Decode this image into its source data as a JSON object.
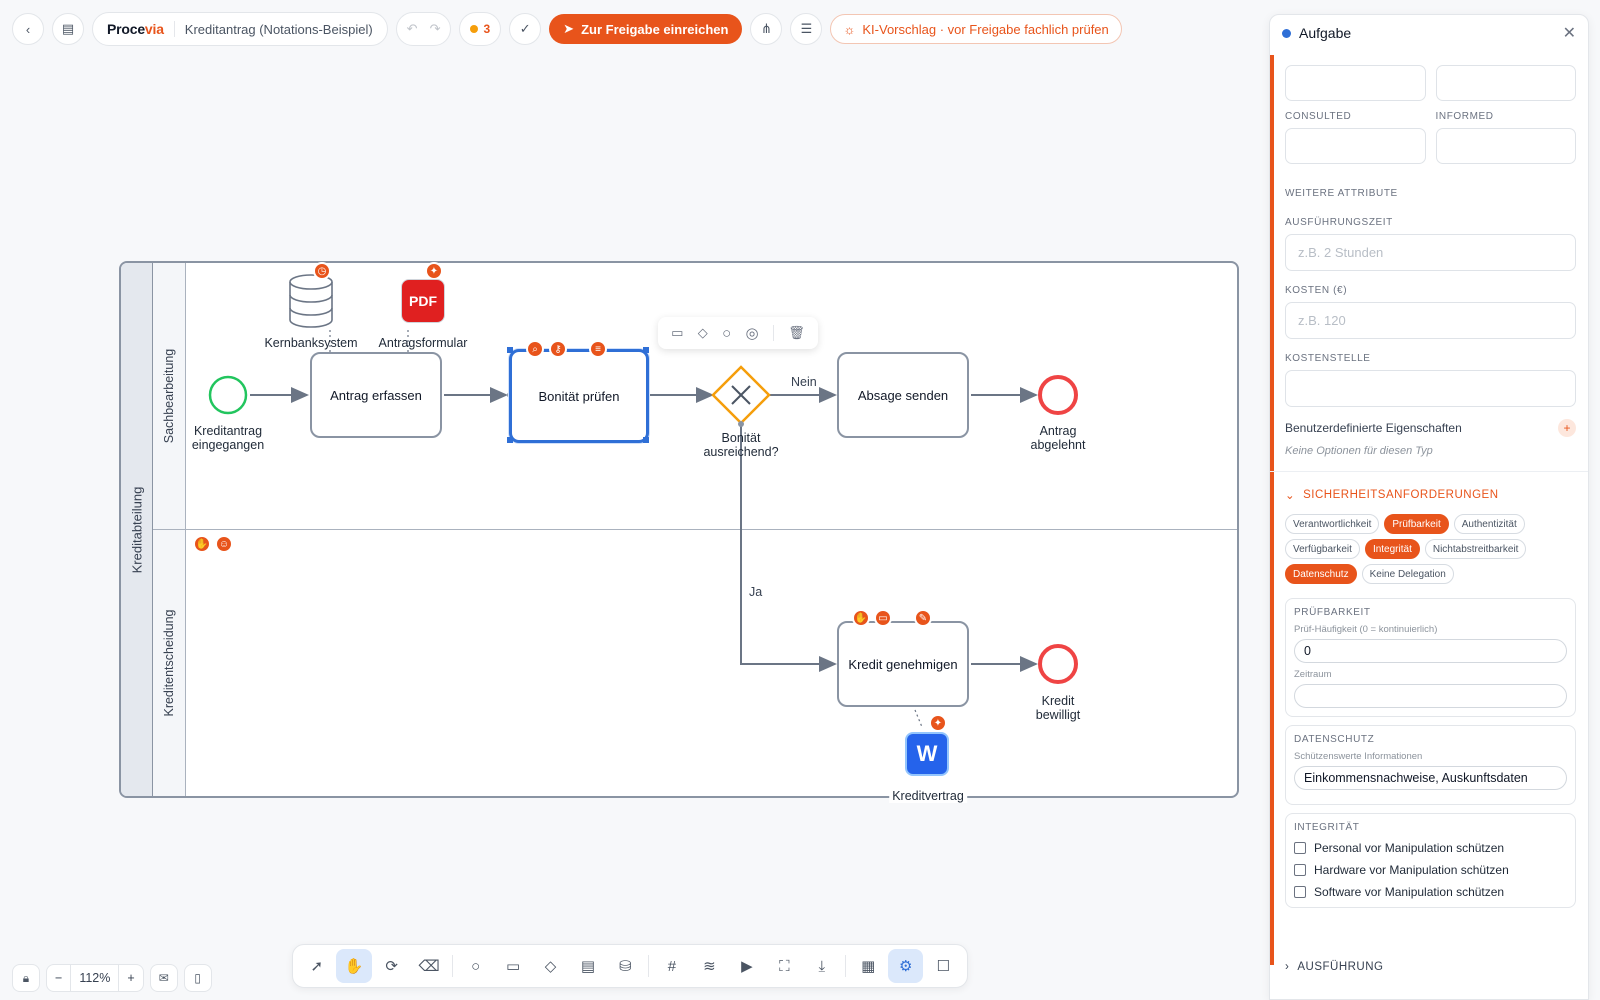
{
  "toolbar": {
    "brand_main": "Proce",
    "brand_accent": "via",
    "doc_title": "Kreditantrag (Notations-Beispiel)",
    "issue_count": "3",
    "submit_label": "Zur Freigabe einreichen",
    "ai_label": "KI-Vorschlag · vor Freigabe fachlich prüfen",
    "icons": [
      "back-icon",
      "document-icon",
      "undo-icon",
      "redo-icon",
      "check-icon",
      "send-icon",
      "share-icon",
      "menu-icon",
      "sparkle-icon"
    ]
  },
  "diagram": {
    "pool": "Kreditabteilung",
    "lanes": [
      "Sachbearbeitung",
      "Kreditentscheidung"
    ],
    "start_event": "Kreditantrag eingegangen",
    "tasks": {
      "capture": "Antrag erfassen",
      "credit_check": "Bonität prüfen",
      "reject": "Absage senden",
      "approve": "Kredit genehmigen"
    },
    "gateway": "Bonität ausreichend?",
    "edge_no": "Nein",
    "edge_yes": "Ja",
    "end_rejected": "Antrag abgelehnt",
    "end_approved": "Kredit bewilligt",
    "artifacts": {
      "database": "Kernbanksystem",
      "pdf": "Antragsformular",
      "pdf_glyph": "PDF",
      "word": "Kreditvertrag",
      "word_glyph": "W"
    },
    "colors": {
      "accent": "#e8541b",
      "selection": "#2f6fd6",
      "start": "#22c55e",
      "end": "#ef4444",
      "gateway": "#f59e0b",
      "stroke": "#8a94a3"
    }
  },
  "zoom": {
    "minus": "−",
    "level": "112%",
    "plus": "+"
  },
  "tools": [
    "select-tool",
    "hand-tool",
    "lasso-tool",
    "eraser-tool",
    "event-tool",
    "task-tool",
    "gateway-tool",
    "lane-tool",
    "datastore-tool",
    "grid-tool",
    "layers-tool",
    "play-tool",
    "fit-tool",
    "download-tool",
    "apps-tool",
    "settings-tool",
    "comment-tool"
  ],
  "panel": {
    "title": "Aufgabe",
    "consulted": "Consulted",
    "informed": "Informed",
    "more_attributes": "Weitere Attribute",
    "exec_time_label": "Ausführungszeit",
    "exec_time_placeholder": "z.B. 2 Stunden",
    "cost_label": "Kosten (€)",
    "cost_placeholder": "z.B. 120",
    "cost_center_label": "Kostenstelle",
    "custom_props": "Benutzerdefinierte Eigenschaften",
    "custom_add": "+",
    "no_options": "Keine Optionen für diesen Typ",
    "security_title": "Sicherheitsanforderungen",
    "chips": [
      {
        "label": "Verantwortlichkeit",
        "on": false
      },
      {
        "label": "Prüfbarkeit",
        "on": true
      },
      {
        "label": "Authentizität",
        "on": false
      },
      {
        "label": "Verfügbarkeit",
        "on": false
      },
      {
        "label": "Integrität",
        "on": true
      },
      {
        "label": "Nichtabstreitbarkeit",
        "on": false
      },
      {
        "label": "Datenschutz",
        "on": true
      },
      {
        "label": "Keine Delegation",
        "on": false
      }
    ],
    "audit": {
      "title": "Prüfbarkeit",
      "freq_label": "Prüf-Häufigkeit (0 = kontinuierlich)",
      "freq_value": "0",
      "period_label": "Zeitraum",
      "period_value": ""
    },
    "privacy": {
      "title": "Datenschutz",
      "info_label": "Schützenswerte Informationen",
      "info_value": "Einkommensnachweise, Auskunftsdaten"
    },
    "integrity": {
      "title": "Integrität",
      "items": [
        "Personal vor Manipulation schützen",
        "Hardware vor Manipulation schützen",
        "Software vor Manipulation schützen"
      ]
    },
    "execution_title": "Ausführung"
  }
}
